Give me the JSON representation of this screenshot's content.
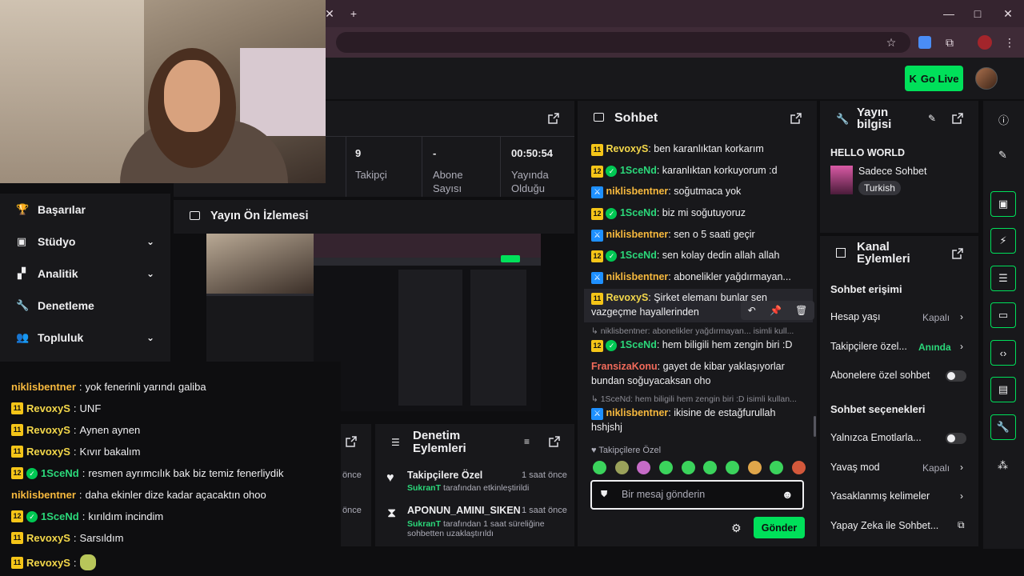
{
  "stats": [
    {
      "value": "9",
      "label": "Takipçi"
    },
    {
      "value": "-",
      "label": "Abone Sayısı"
    },
    {
      "value": "00:50:54",
      "label": "Yayında Olduğu"
    }
  ],
  "nav": [
    {
      "label": "Başarılar",
      "icon": "trophy-icon"
    },
    {
      "label": "Stüdyo",
      "icon": "camera-icon"
    },
    {
      "label": "Analitik",
      "icon": "analytics-icon"
    },
    {
      "label": "Denetleme",
      "icon": "wrench-icon"
    },
    {
      "label": "Topluluk",
      "icon": "community-icon"
    }
  ],
  "preview_title": "Yayın Ön İzlemesi",
  "left_chat": [
    {
      "user": "niklisbentner",
      "text": "yok fenerinli yarındı galiba",
      "badges": []
    },
    {
      "user": "RevoxyS",
      "text": "UNF",
      "badges": [
        "11"
      ]
    },
    {
      "user": "RevoxyS",
      "text": "Aynen aynen",
      "badges": [
        "11"
      ]
    },
    {
      "user": "RevoxyS",
      "text": "Kıvır bakalım",
      "badges": [
        "11"
      ]
    },
    {
      "user": "1SceNd",
      "text": "resmen ayrımcılık bak biz temiz fenerliydik",
      "badges": [
        "12",
        "verified"
      ]
    },
    {
      "user": "niklisbentner",
      "text": "daha ekinler dize kadar açacaktın ohoo",
      "badges": []
    },
    {
      "user": "1SceNd",
      "text": "kırıldım incindim",
      "badges": [
        "12",
        "verified"
      ]
    },
    {
      "user": "RevoxyS",
      "text": "Sarsıldım",
      "badges": [
        "11"
      ]
    },
    {
      "user": "RevoxyS",
      "text": "",
      "badges": [
        "11"
      ]
    }
  ],
  "moderation": {
    "title": "Denetim Eylemleri",
    "items": [
      {
        "title": "Takipçilere Özel",
        "time": "1 saat önce",
        "actor": "SukranT",
        "desc": "tarafından etkinleştirildi",
        "icon": "heart-icon"
      },
      {
        "title": "APONUN_AMINI_SIKEN",
        "time": "1 saat önce",
        "actor": "SukranT",
        "desc": "tarafından 1 saat süreliğine sohbetten uzaklaştırıldı",
        "icon": "hourglass-icon"
      }
    ],
    "partial_times": [
      "önce",
      "önce"
    ]
  },
  "chat": {
    "title": "Sohbet",
    "messages": [
      {
        "user": "RevoxyS",
        "badge": "11",
        "text": "ben karanlıktan korkarım"
      },
      {
        "user": "1SceNd",
        "badge": "12",
        "verified": true,
        "text": "karanlıktan korkuyorum :d"
      },
      {
        "user": "niklisbentner",
        "badge": "mod",
        "text": "soğutmaca yok"
      },
      {
        "user": "1SceNd",
        "badge": "12",
        "verified": true,
        "text": "biz mi soğutuyoruz"
      },
      {
        "user": "niklisbentner",
        "badge": "mod",
        "text": "sen o 5 saati geçir"
      },
      {
        "user": "1SceNd",
        "badge": "12",
        "verified": true,
        "text": "sen kolay dedin allah allah"
      },
      {
        "user": "niklisbentner",
        "badge": "mod",
        "text": "abonelikler yağdırmayan..."
      },
      {
        "user": "RevoxyS",
        "badge": "11",
        "text": "Şirket elemanı bunlar sen vazgeçme hayallerinden"
      },
      {
        "reply": "niklisbentner: abonelikler yağdırmayan... isimli kull..."
      },
      {
        "user": "1SceNd",
        "badge": "12",
        "verified": true,
        "text": "hem biligili hem zengin biri :D"
      },
      {
        "user": "FransizaKonu",
        "text": "gayet de kibar yaklaşıyorlar bundan soğuyacaksan oho"
      },
      {
        "reply": "1SceNd: hem biligili hem zengin biri :D isimli kullan..."
      },
      {
        "user": "niklisbentner",
        "badge": "mod",
        "text": "ikisine de estağfurullah hshjshj"
      }
    ],
    "mode_label": "Takipçilere Özel",
    "input_placeholder": "Bir mesaj gönderin",
    "send_label": "Gönder"
  },
  "stream_info": {
    "title": "Yayın bilgisi",
    "stream_title": "HELLO WORLD",
    "category": "Sadece Sohbet",
    "tag": "Turkish"
  },
  "channel_actions": {
    "title": "Kanal Eylemleri",
    "section1": "Sohbet erişimi",
    "rows1": [
      {
        "label": "Hesap yaşı",
        "value": "Kapalı"
      },
      {
        "label": "Takipçilere özel...",
        "value": "Anında"
      },
      {
        "label": "Abonelere özel sohbet",
        "value": ""
      }
    ],
    "section2": "Sohbet seçenekleri",
    "rows2": [
      {
        "label": "Yalnızca Emotlarla...",
        "value": ""
      },
      {
        "label": "Yavaş mod",
        "value": "Kapalı"
      },
      {
        "label": "Yasaklanmış kelimeler",
        "value": ""
      },
      {
        "label": "Yapay Zeka ile Sohbet...",
        "value": ""
      }
    ]
  },
  "topbar": {
    "golive_label": "Go Live"
  },
  "colors": {
    "accent": "#00e05a",
    "panel": "#18181b",
    "bg": "#0e0e10",
    "chrome": "#35242f"
  }
}
